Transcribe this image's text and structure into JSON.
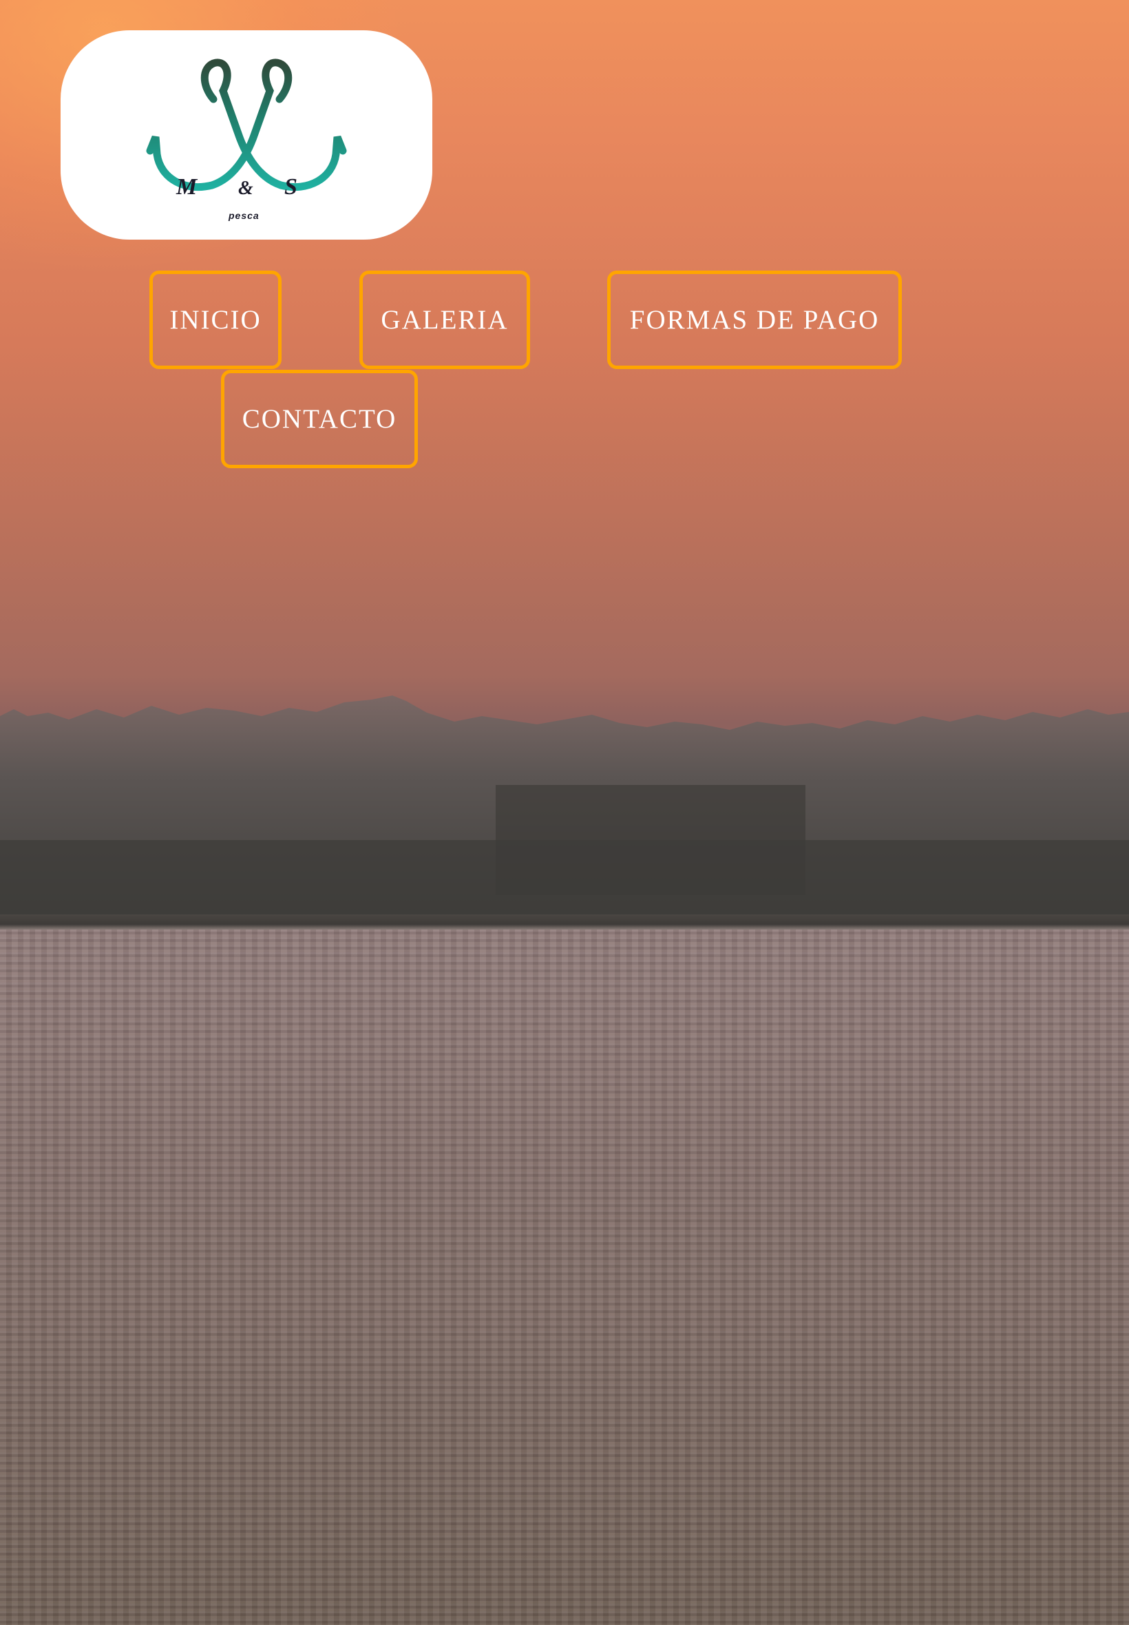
{
  "logo": {
    "brand_text_left": "M",
    "brand_text_amp": "&",
    "brand_text_right": "S",
    "brand_subtext": "pesca"
  },
  "nav": {
    "items": [
      {
        "label": "INICIO"
      },
      {
        "label": "GALERIA"
      },
      {
        "label": "FORMAS DE PAGO"
      },
      {
        "label": "CONTACTO"
      }
    ]
  },
  "colors": {
    "button_border": "#ffa500",
    "button_text": "#ffffff",
    "logo_hook_teal": "#1aa89a",
    "logo_hook_dark": "#2f4a3a"
  },
  "background": {
    "scene": "sunset-over-water"
  }
}
